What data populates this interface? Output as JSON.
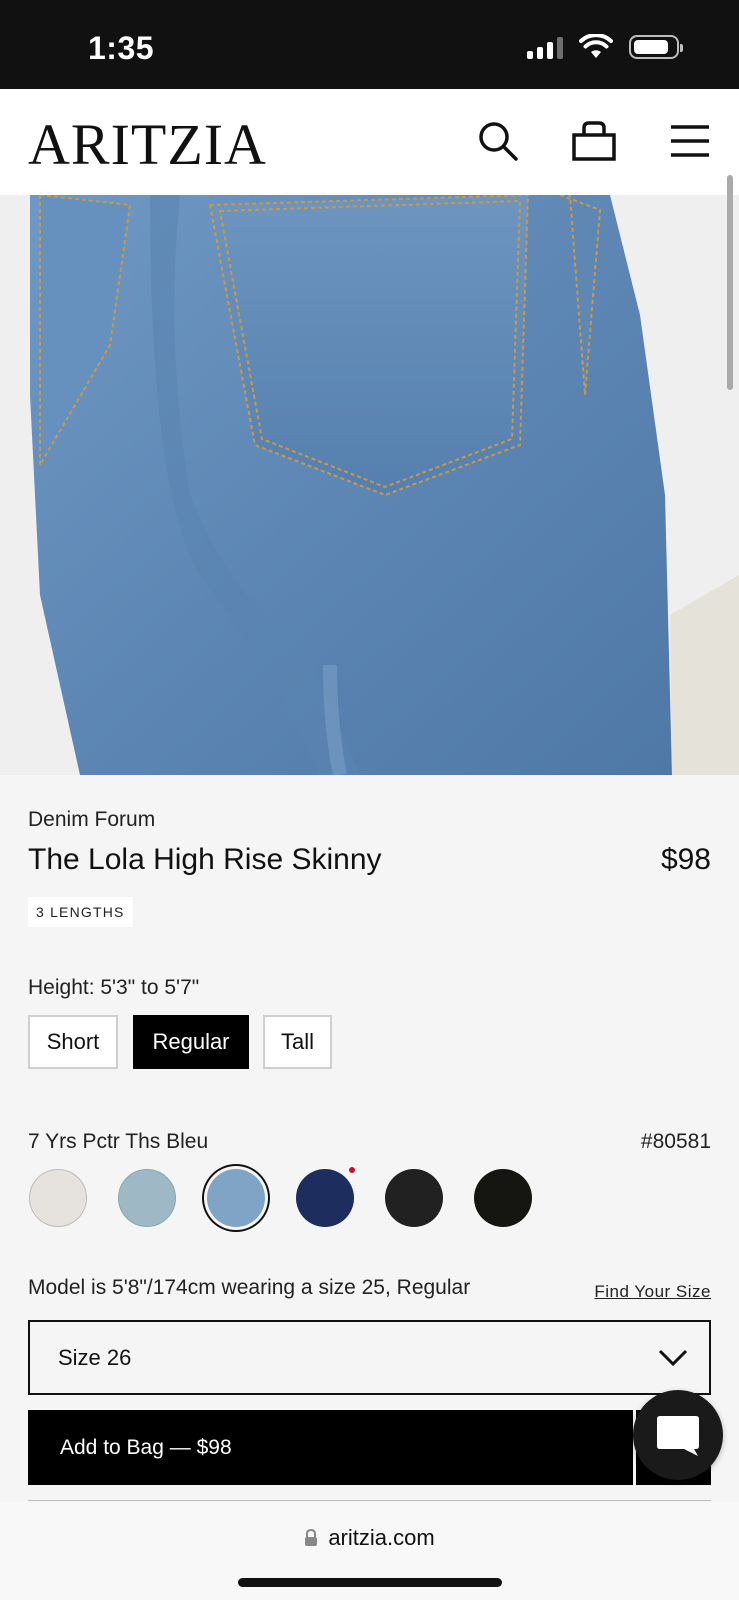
{
  "status_bar": {
    "time": "1:35"
  },
  "header": {
    "logo": "ARITZIA",
    "icons": [
      "search-icon",
      "bag-icon",
      "menu-icon"
    ]
  },
  "product": {
    "brand": "Denim Forum",
    "title": "The Lola High Rise Skinny",
    "price": "$98",
    "lengths_badge": "3 LENGTHS",
    "height_label": "Height: 5'3\" to 5'7\"",
    "lengths": [
      {
        "label": "Short",
        "selected": false
      },
      {
        "label": "Regular",
        "selected": true
      },
      {
        "label": "Tall",
        "selected": false
      }
    ],
    "color_name": "7 Yrs Pctr Ths Bleu",
    "style_number": "#80581",
    "swatches": [
      {
        "color": "#e6e3df",
        "selected": false
      },
      {
        "color": "#9fb8c6",
        "selected": false
      },
      {
        "color": "#7fa4c6",
        "selected": true
      },
      {
        "color": "#1c2d5e",
        "selected": false,
        "new_dot": true
      },
      {
        "color": "#212121",
        "selected": false
      },
      {
        "color": "#151611",
        "selected": false
      }
    ],
    "model_info": "Model is 5'8\"/174cm wearing a size 25, Regular",
    "find_size_link": "Find Your Size",
    "size_select_value": "Size 26",
    "add_to_bag_label": "Add to Bag — $98"
  },
  "browser": {
    "url": "aritzia.com"
  },
  "colors": {
    "accent": "#000000",
    "background": "#f5f5f5",
    "sale_dot": "#c8102e"
  }
}
